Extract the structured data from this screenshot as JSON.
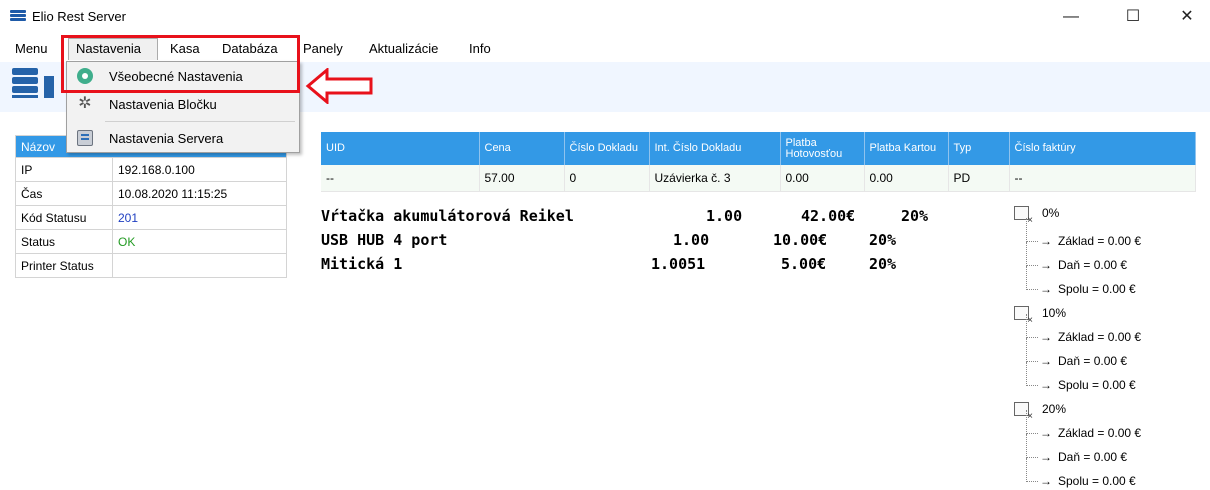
{
  "window": {
    "title": "Elio Rest Server",
    "minimize": "—",
    "maximize": "☐",
    "close": "✕"
  },
  "menu": [
    "Menu",
    "Nastavenia",
    "Kasa",
    "Databáza",
    "Panely",
    "Aktualizácie",
    "Info"
  ],
  "dropdown": {
    "items": [
      {
        "label": "Všeobecné Nastavenia",
        "icon": "general-settings-icon"
      },
      {
        "label": "Nastavenia Bločku",
        "icon": "gear-icon"
      },
      {
        "label": "Nastavenia Servera",
        "icon": "server-icon"
      }
    ]
  },
  "annotation_color": "#e8111b",
  "info": {
    "header": "Názov",
    "rows": [
      {
        "key": "IP",
        "value": "192.168.0.100",
        "color": ""
      },
      {
        "key": "Čas",
        "value": "10.08.2020 11:15:25",
        "color": ""
      },
      {
        "key": "Kód Statusu",
        "value": "201",
        "color": "#1f3fc1"
      },
      {
        "key": "Status",
        "value": "OK",
        "color": "#239b23"
      },
      {
        "key": "Printer Status",
        "value": "",
        "color": ""
      }
    ]
  },
  "grid": {
    "columns": [
      "UID",
      "Cena",
      "Číslo Dokladu",
      "Int. Číslo Dokladu",
      "Platba Hotovosťou",
      "Platba Kartou",
      "Typ",
      "Číslo faktúry"
    ],
    "rows": [
      [
        "--",
        "57.00",
        "0",
        "Uzávierka č. 3",
        "0.00",
        "0.00",
        "PD",
        "--"
      ]
    ]
  },
  "receipt": [
    {
      "name": "Vŕtačka akumulátorová Reikel",
      "qty": "1.00",
      "price": "42.00€",
      "vat": "20%"
    },
    {
      "name": "USB HUB 4 port",
      "qty": "1.00",
      "price": "10.00€",
      "vat": "20%"
    },
    {
      "name": "Mitická 1",
      "qty": "1.0051",
      "price": "5.00€",
      "vat": "20%"
    }
  ],
  "tax_tree": [
    {
      "rate": "0%",
      "children": [
        "Základ = 0.00 €",
        "Daň = 0.00 €",
        "Spolu = 0.00 €"
      ]
    },
    {
      "rate": "10%",
      "children": [
        "Základ = 0.00 €",
        "Daň = 0.00 €",
        "Spolu = 0.00 €"
      ]
    },
    {
      "rate": "20%",
      "children": [
        "Základ = 0.00 €",
        "Daň = 0.00 €",
        "Spolu = 0.00 €"
      ]
    }
  ],
  "arrow_glyph": "→"
}
